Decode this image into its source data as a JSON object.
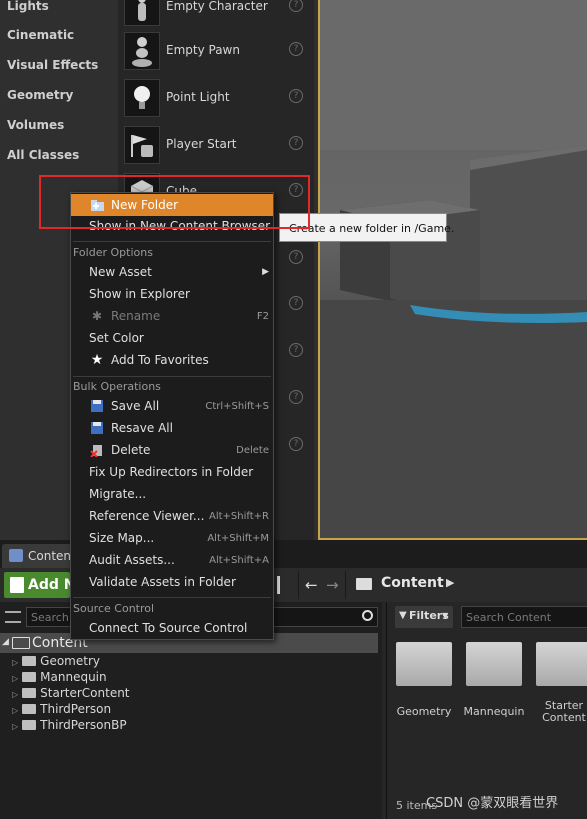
{
  "place_actors": {
    "categories": [
      "Lights",
      "Cinematic",
      "Visual Effects",
      "Geometry",
      "Volumes",
      "All Classes"
    ],
    "actors": [
      {
        "label": "Empty Character",
        "icon": "character-icon"
      },
      {
        "label": "Empty Pawn",
        "icon": "pawn-icon"
      },
      {
        "label": "Point Light",
        "icon": "light-bulb-icon"
      },
      {
        "label": "Player Start",
        "icon": "player-start-icon"
      },
      {
        "label": "Cube",
        "icon": "cube-icon"
      }
    ],
    "help_glyph": "?"
  },
  "context_menu": {
    "top_items": [
      "New Folder",
      "Show in New Content Browser"
    ],
    "folder_options_header": "Folder Options",
    "folder_options": [
      {
        "label": "New Asset",
        "submenu": true
      },
      {
        "label": "Show in Explorer"
      },
      {
        "label": "Rename",
        "shortcut": "F2",
        "disabled": true
      },
      {
        "label": "Set Color"
      },
      {
        "label": "Add To Favorites"
      }
    ],
    "bulk_header": "Bulk Operations",
    "bulk": [
      {
        "label": "Save All",
        "shortcut": "Ctrl+Shift+S"
      },
      {
        "label": "Resave All"
      },
      {
        "label": "Delete",
        "shortcut": "Delete"
      },
      {
        "label": "Fix Up Redirectors in Folder"
      },
      {
        "label": "Migrate..."
      },
      {
        "label": "Reference Viewer...",
        "shortcut": "Alt+Shift+R"
      },
      {
        "label": "Size Map...",
        "shortcut": "Alt+Shift+M"
      },
      {
        "label": "Audit Assets...",
        "shortcut": "Alt+Shift+A"
      },
      {
        "label": "Validate Assets in Folder"
      }
    ],
    "source_header": "Source Control",
    "source": [
      "Connect To Source Control"
    ]
  },
  "tooltip": {
    "text": "Create a new folder in /Game."
  },
  "content_browser": {
    "tab_label": "Conten",
    "add_new_label": "Add N",
    "breadcrumb": "Content",
    "tree_search_placeholder": "Search",
    "tree_root": "Content",
    "folders": [
      "Geometry",
      "Mannequin",
      "StarterContent",
      "ThirdPerson",
      "ThirdPersonBP"
    ],
    "filters_label": "Filters",
    "asset_search_placeholder": "Search Content",
    "tiles": [
      "Geometry",
      "Mannequin",
      "Starter\nContent"
    ],
    "item_count": "5 items"
  },
  "watermark": "CSDN @蒙双眼看世界",
  "colors": {
    "highlight": "#e0862a",
    "add_new": "#4a8a2e",
    "annotation_box": "#e02a2a",
    "viewport_border": "#c7a44a"
  }
}
